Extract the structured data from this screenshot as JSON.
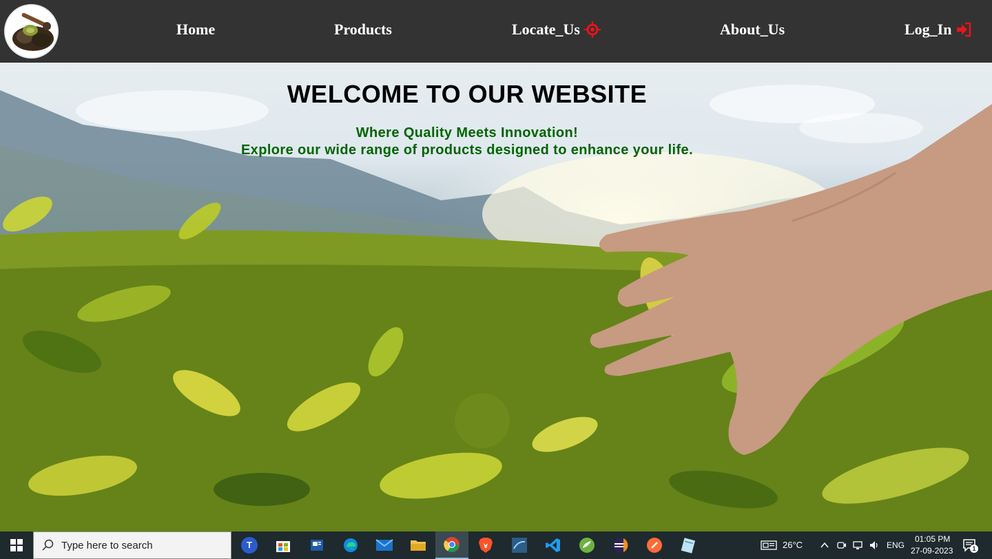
{
  "nav": {
    "links": [
      {
        "label": "Home"
      },
      {
        "label": "Products"
      },
      {
        "label": "Locate_Us",
        "icon": "location-target-icon"
      },
      {
        "label": "About_Us"
      },
      {
        "label": "Log_In",
        "icon": "login-arrow-icon"
      }
    ],
    "logo_icon": "tea-leaves-logo"
  },
  "hero": {
    "title": "WELCOME TO OUR WEBSITE",
    "subtitle_line1": "Where Quality Meets Innovation!",
    "subtitle_line2": "Explore our wide range of products designed to enhance your life.",
    "background_image": "tea-plantation-hand-photo",
    "accent_color": "#006400"
  },
  "taskbar": {
    "search_placeholder": "Type here to search",
    "apps": [
      "teams-icon",
      "store-icon",
      "news-icon",
      "edge-icon",
      "mail-icon",
      "file-explorer-icon",
      "chrome-icon",
      "brave-icon",
      "mysql-workbench-icon",
      "vscode-icon",
      "spring-tools-icon",
      "eclipse-icon",
      "postman-icon",
      "notepad-icon"
    ],
    "active_app": "chrome-icon",
    "weather": "26°C",
    "language": "ENG",
    "time": "01:05 PM",
    "date": "27-09-2023",
    "notification_count": "1"
  },
  "colors": {
    "navbar_bg": "#333333",
    "nav_icon_red": "#e8141b",
    "taskbar_bg": "#1f2a2e"
  }
}
